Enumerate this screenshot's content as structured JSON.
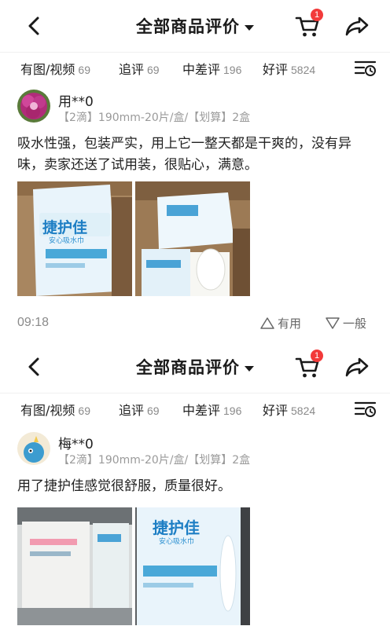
{
  "header": {
    "title": "全部商品评价",
    "cart_badge": "1"
  },
  "tabs": [
    {
      "label": "有图/视频",
      "count": "69"
    },
    {
      "label": "追评",
      "count": "69"
    },
    {
      "label": "中差评",
      "count": "196"
    },
    {
      "label": "好评",
      "count": "5824"
    }
  ],
  "reviews": [
    {
      "username": "用**0",
      "spec": "【2滴】190mm-20片/盒/【划算】2盒",
      "content": "吸水性强，包装严实，用上它一整天都是干爽的，没有异味，卖家还送了试用装，很贴心，满意。",
      "photo_brand": "捷护佳",
      "photo_brand_small": "安心吸水巾",
      "time": "09:18",
      "useful_label": "有用",
      "normal_label": "一般"
    },
    {
      "username": "梅**0",
      "spec": "【2滴】190mm-20片/盒/【划算】2盒",
      "content": "用了捷护佳感觉很舒服，质量很好。",
      "photo_brand": "捷护佳",
      "photo_brand_small": "安心吸水巾"
    }
  ]
}
